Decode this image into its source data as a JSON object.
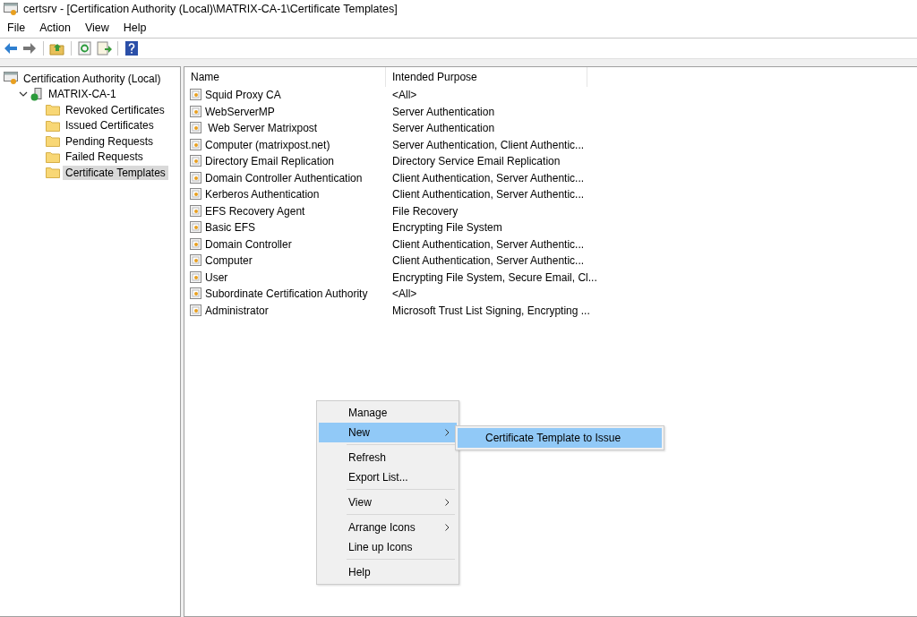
{
  "window": {
    "title": "certsrv - [Certification Authority (Local)\\MATRIX-CA-1\\Certificate Templates]"
  },
  "menu_bar": [
    "File",
    "Action",
    "View",
    "Help"
  ],
  "tree": [
    {
      "label": "Certification Authority (Local)",
      "kind": "root",
      "selected": false,
      "children": [
        {
          "label": "MATRIX-CA-1",
          "kind": "server",
          "expanded": true,
          "selected": false,
          "children": [
            {
              "label": "Revoked Certificates",
              "kind": "folder",
              "selected": false
            },
            {
              "label": "Issued Certificates",
              "kind": "folder",
              "selected": false
            },
            {
              "label": "Pending Requests",
              "kind": "folder",
              "selected": false
            },
            {
              "label": "Failed Requests",
              "kind": "folder",
              "selected": false
            },
            {
              "label": "Certificate Templates",
              "kind": "folder",
              "selected": true
            }
          ]
        }
      ]
    }
  ],
  "table": {
    "columns": [
      "Name",
      "Intended Purpose"
    ],
    "rows": [
      {
        "name": "Squid Proxy CA",
        "purpose": "<All>"
      },
      {
        "name": "WebServerMP",
        "purpose": "Server Authentication"
      },
      {
        "name": " Web Server Matrixpost",
        "purpose": "Server Authentication"
      },
      {
        "name": "Computer (matrixpost.net)",
        "purpose": "Server Authentication, Client Authentic..."
      },
      {
        "name": "Directory Email Replication",
        "purpose": "Directory Service Email Replication"
      },
      {
        "name": "Domain Controller Authentication",
        "purpose": "Client Authentication, Server Authentic..."
      },
      {
        "name": "Kerberos Authentication",
        "purpose": "Client Authentication, Server Authentic..."
      },
      {
        "name": "EFS Recovery Agent",
        "purpose": "File Recovery"
      },
      {
        "name": "Basic EFS",
        "purpose": "Encrypting File System"
      },
      {
        "name": "Domain Controller",
        "purpose": "Client Authentication, Server Authentic..."
      },
      {
        "name": "Computer",
        "purpose": "Client Authentication, Server Authentic..."
      },
      {
        "name": "User",
        "purpose": "Encrypting File System, Secure Email, Cl..."
      },
      {
        "name": "Subordinate Certification Authority",
        "purpose": "<All>"
      },
      {
        "name": "Administrator",
        "purpose": "Microsoft Trust List Signing, Encrypting ..."
      }
    ]
  },
  "context_menu": {
    "items": [
      {
        "kind": "item",
        "label": "Manage",
        "selected": false,
        "has_submenu": false
      },
      {
        "kind": "item",
        "label": "New",
        "selected": true,
        "has_submenu": true
      },
      {
        "kind": "separator"
      },
      {
        "kind": "item",
        "label": "Refresh",
        "selected": false,
        "has_submenu": false
      },
      {
        "kind": "item",
        "label": "Export List...",
        "selected": false,
        "has_submenu": false
      },
      {
        "kind": "separator"
      },
      {
        "kind": "item",
        "label": "View",
        "selected": false,
        "has_submenu": true
      },
      {
        "kind": "separator"
      },
      {
        "kind": "item",
        "label": "Arrange Icons",
        "selected": false,
        "has_submenu": true
      },
      {
        "kind": "item",
        "label": "Line up Icons",
        "selected": false,
        "has_submenu": false
      },
      {
        "kind": "separator"
      },
      {
        "kind": "item",
        "label": "Help",
        "selected": false,
        "has_submenu": false
      }
    ],
    "submenu": [
      {
        "label": "Certificate Template to Issue",
        "selected": true
      }
    ]
  }
}
